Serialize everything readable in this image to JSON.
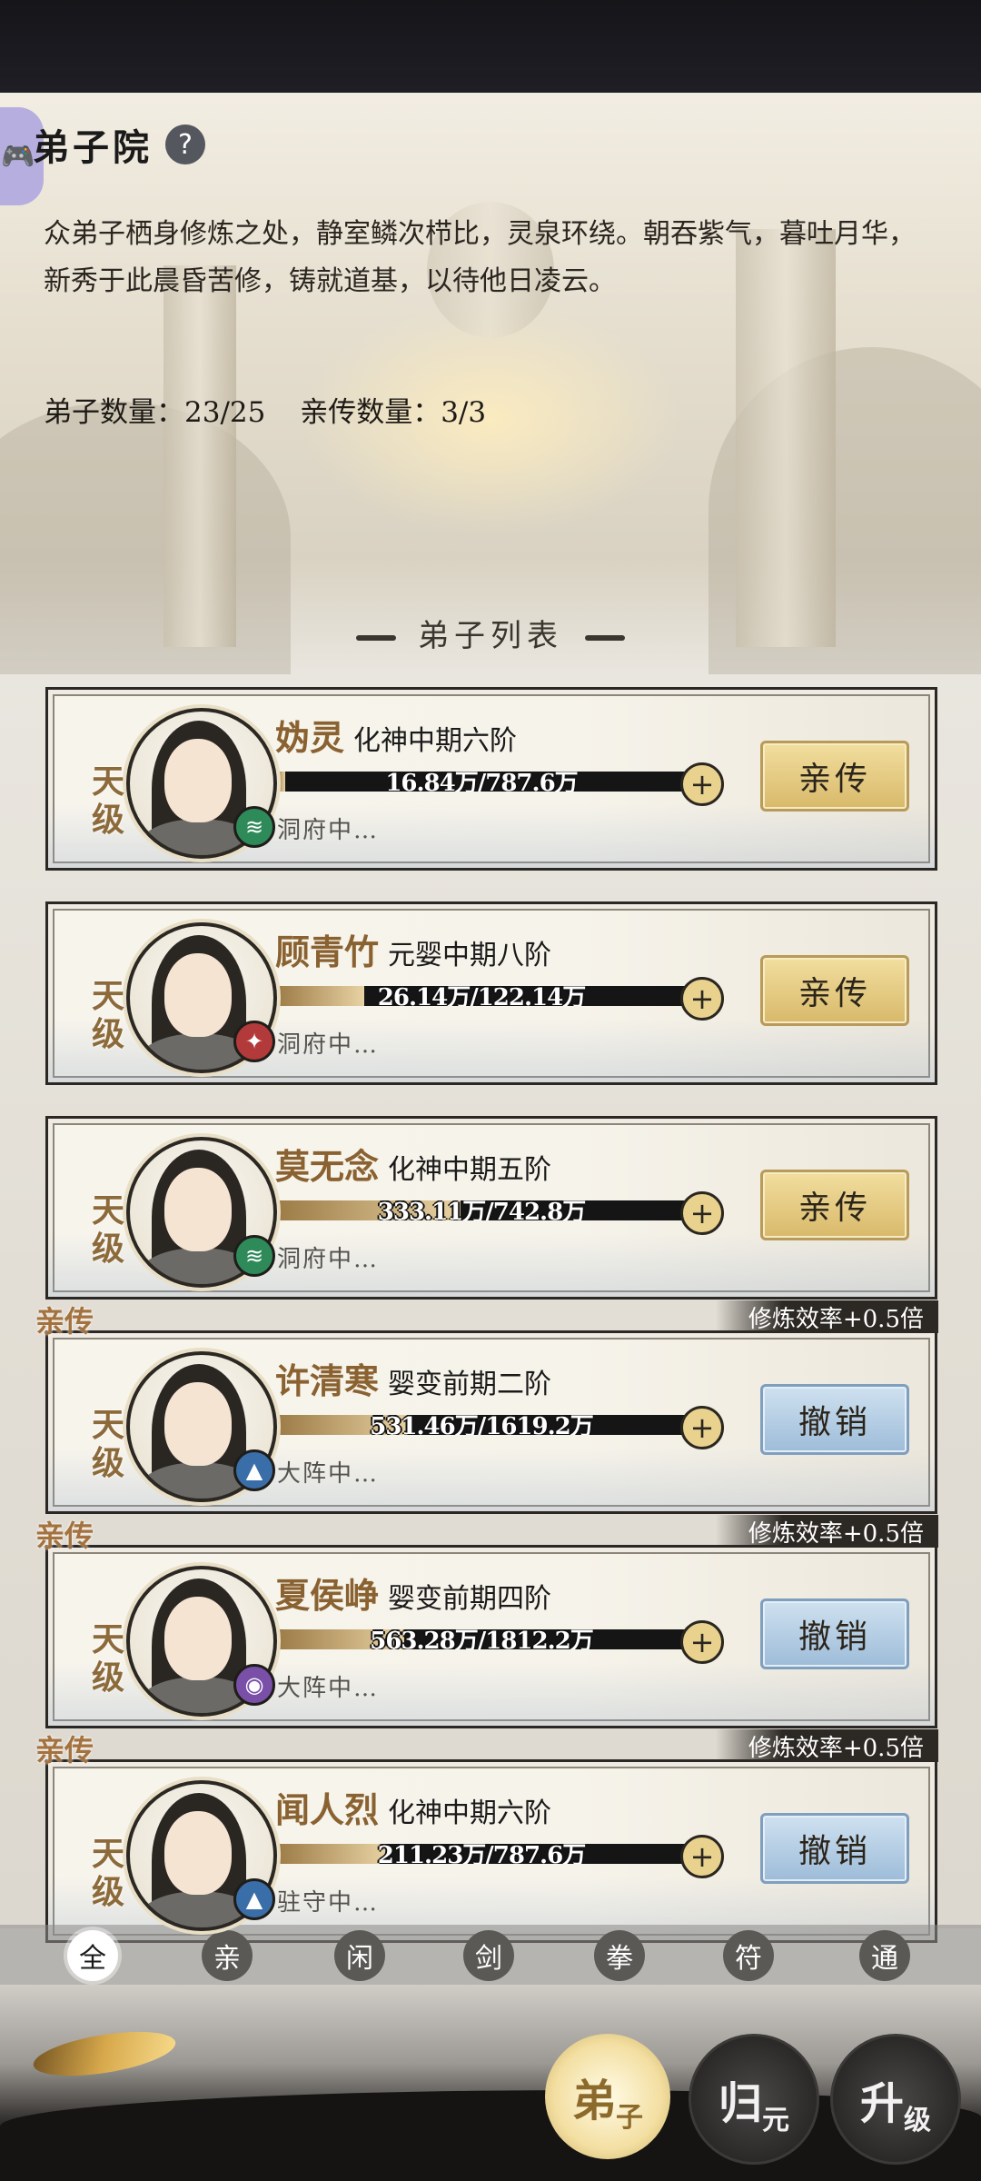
{
  "header": {
    "title": "弟子院",
    "help_icon": "?",
    "side_tab_icon": "🎮",
    "description": "众弟子栖身修炼之处，静室鳞次栉比，灵泉环绕。朝吞紫气，暮吐月华，新秀于此晨昏苦修，铸就道基，以待他日凌云。",
    "disciple_count": "弟子数量：23/25",
    "direct_count": "亲传数量：3/3"
  },
  "list_title": "弟子列表",
  "disciples": [
    {
      "grade": "天级",
      "name": "妫灵",
      "realm": "化神中期六阶",
      "progress_text": "16.84万/787.6万",
      "progress": 0.021,
      "status": "洞府中…",
      "action": "亲传",
      "element_icon": "wind-element-icon",
      "element_color": "#2f8a5a",
      "direct": false
    },
    {
      "grade": "天级",
      "name": "顾青竹",
      "realm": "元婴中期八阶",
      "progress_text": "26.14万/122.14万",
      "progress": 0.214,
      "status": "洞府中…",
      "action": "亲传",
      "element_icon": "fire-element-icon",
      "element_color": "#b23a3a",
      "direct": false
    },
    {
      "grade": "天级",
      "name": "莫无念",
      "realm": "化神中期五阶",
      "progress_text": "333.11万/742.8万",
      "progress": 0.448,
      "status": "洞府中…",
      "action": "亲传",
      "element_icon": "wind-element-icon",
      "element_color": "#2f8a5a",
      "direct": false
    },
    {
      "grade": "天级",
      "name": "许清寒",
      "realm": "婴变前期二阶",
      "progress_text": "531.46万/1619.2万",
      "progress": 0.328,
      "status": "大阵中…",
      "action": "撤销",
      "element_icon": "water-element-icon",
      "element_color": "#3a6ea8",
      "direct": true,
      "tag": "亲传",
      "bonus": "修炼效率+0.5倍"
    },
    {
      "grade": "天级",
      "name": "夏侯峥",
      "realm": "婴变前期四阶",
      "progress_text": "563.28万/1812.2万",
      "progress": 0.311,
      "status": "大阵中…",
      "action": "撤销",
      "element_icon": "thunder-element-icon",
      "element_color": "#7a4fa8",
      "direct": true,
      "tag": "亲传",
      "bonus": "修炼效率+0.5倍"
    },
    {
      "grade": "天级",
      "name": "闻人烈",
      "realm": "化神中期六阶",
      "progress_text": "211.23万/787.6万",
      "progress": 0.268,
      "status": "驻守中…",
      "action": "撤销",
      "element_icon": "water-element-icon",
      "element_color": "#3a6ea8",
      "direct": true,
      "tag": "亲传",
      "bonus": "修炼效率+0.5倍"
    }
  ],
  "filters": [
    "全",
    "亲",
    "闲",
    "剑",
    "拳",
    "符",
    "通"
  ],
  "active_filter": "全",
  "bottom_nav": {
    "disciple": [
      "弟",
      "子"
    ],
    "guiyuan": [
      "归",
      "元"
    ],
    "upgrade": [
      "升",
      "级"
    ]
  }
}
